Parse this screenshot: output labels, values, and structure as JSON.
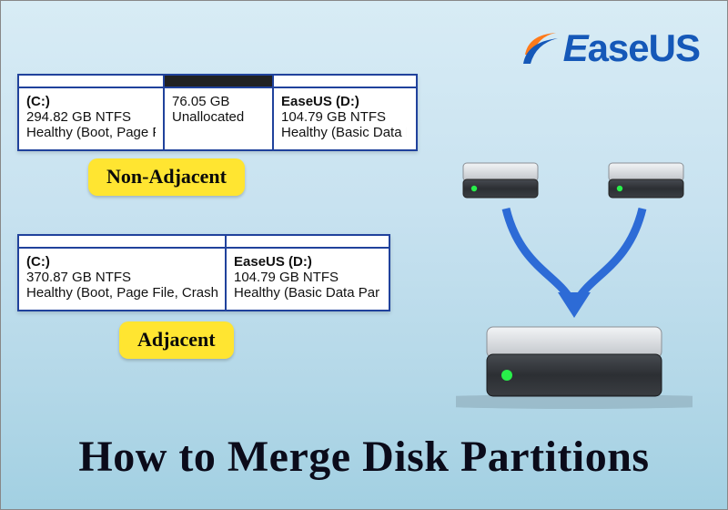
{
  "brand": {
    "name": "EaseUS"
  },
  "table1": {
    "label": "Non-Adjacent",
    "cols": [
      {
        "title": "(C:)",
        "size": "294.82 GB NTFS",
        "status": "Healthy (Boot, Page File, Cras"
      },
      {
        "title": "",
        "size": "76.05 GB",
        "status": "Unallocated"
      },
      {
        "title": "EaseUS  (D:)",
        "size": "104.79 GB NTFS",
        "status": "Healthy (Basic Data Partitio"
      }
    ]
  },
  "table2": {
    "label": "Adjacent",
    "cols": [
      {
        "title": "(C:)",
        "size": "370.87 GB NTFS",
        "status": "Healthy (Boot, Page File, Crash Dump, I"
      },
      {
        "title": "EaseUS  (D:)",
        "size": "104.79 GB NTFS",
        "status": "Healthy (Basic Data Partition)"
      }
    ]
  },
  "title": "How to Merge Disk Partitions"
}
